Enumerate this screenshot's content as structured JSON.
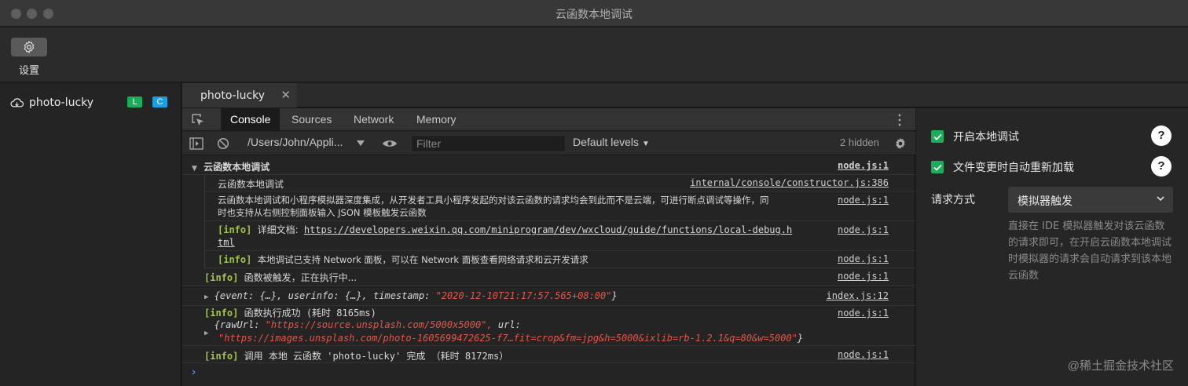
{
  "window": {
    "title": "云函数本地调试"
  },
  "toolbar": {
    "settings_label": "设置"
  },
  "sidebar": {
    "project_name": "photo-lucky",
    "badge_l": "L",
    "badge_c": "C",
    "badge_l_color": "#1aad5a",
    "badge_c_color": "#1a9fe0"
  },
  "file_tab": {
    "label": "photo-lucky",
    "close": "✕"
  },
  "devtools": {
    "tabs": [
      "Console",
      "Sources",
      "Network",
      "Memory"
    ],
    "context": "/Users/John/Appli...",
    "filter_placeholder": "Filter",
    "levels": "Default levels",
    "hidden": "2 hidden"
  },
  "console": {
    "group_title": "云函数本地调试",
    "group_src": "node.js:1",
    "lines": [
      {
        "text": "云函数本地调试",
        "src": "internal/console/constructor.js:386"
      },
      {
        "text1": "云函数本地调试和小程序模拟器深度集成，从开发者工具小程序发起的对该云函数的请求均会到此而不是云端，可进行断点调试等操作，同",
        "text2": "时也支持从右侧控制面板输入 JSON 模板触发云函数",
        "src": "node.js:1"
      },
      {
        "tag": "[info]",
        "label": "详细文档:",
        "url1": "https://developers.weixin.qq.com/miniprogram/dev/wxcloud/guide/functions/local-debug.h",
        "url2": "tml",
        "src": "node.js:1"
      },
      {
        "tag": "[info]",
        "text": "本地调试已支持 Network 面板，可以在 Network 面板查看网络请求和云开发请求",
        "src": "node.js:1"
      }
    ],
    "triggered": {
      "tag": "[info]",
      "text": "函数被触发，正在执行中...",
      "src": "node.js:1"
    },
    "event_obj": {
      "k1": "{event:",
      "v1": "{…},",
      "k2": "userinfo:",
      "v2": "{…},",
      "k3": "timestamp:",
      "v3": "\"2020-12-10T21:17:57.565+08:00\"",
      "end": "}",
      "src": "index.js:12"
    },
    "success": {
      "tag": "[info]",
      "text": "函数执行成功 (耗时 8165ms)",
      "src": "node.js:1",
      "k1": "{rawUrl:",
      "v1": "\"https://source.unsplash.com/5000x5000\",",
      "k2": "url:",
      "v2": "\"https://images.unsplash.com/photo-1605699472625-f7…fit=crop&fm=jpg&h=5000&ixlib=rb-1.2.1&q=80&w=5000\"",
      "end": "}"
    },
    "done": {
      "tag": "[info]",
      "text": "调用 本地 云函数 'photo-lucky' 完成  （耗时 8172ms）",
      "src": "node.js:1"
    },
    "prompt": "›"
  },
  "right_panel": {
    "enable_local_debug": "开启本地调试",
    "auto_reload": "文件变更时自动重新加载",
    "help": "?",
    "request_mode_label": "请求方式",
    "request_mode_value": "模拟器触发",
    "description": "直接在 IDE 模拟器触发对该云函数的请求即可，在开启云函数本地调试时模拟器的请求会自动请求到该本地云函数"
  },
  "watermark": "@稀土掘金技术社区"
}
